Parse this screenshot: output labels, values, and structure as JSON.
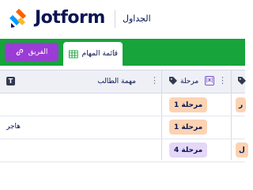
{
  "header": {
    "brand": "Jotform",
    "section": "الجداول"
  },
  "tabbar": {
    "team_button": {
      "label": "الفريق",
      "icon": "link-icon"
    },
    "active_tab": {
      "label": "قائمة المهام",
      "icon": "grid-icon"
    }
  },
  "table": {
    "columns": [
      {
        "label": "مهمة الطالب",
        "icon": "text-type-icon"
      },
      {
        "label": "مرحلة",
        "icon": "tag-icon"
      }
    ],
    "rows": [
      {
        "task": "",
        "stage": "مرحلة 1",
        "stage_color": "#fcd3b2",
        "next_stage": "ر",
        "next_color": "#fcd3b2"
      },
      {
        "task": "هاجر",
        "stage": "مرحلة 1",
        "stage_color": "#fcd3b2",
        "next_stage": "",
        "next_color": ""
      },
      {
        "task": "",
        "stage": "مرحلة 4",
        "stage_color": "#e4d7f7",
        "next_stage": "ل",
        "next_color": "#fcd3b2"
      }
    ]
  },
  "colors": {
    "tabbar_green": "#17a43a",
    "team_purple": "#9b3cd6",
    "brand_navy": "#0a1551",
    "logo_orange": "#ff6100",
    "logo_blue": "#0099ff",
    "logo_yellow": "#ffb629"
  }
}
